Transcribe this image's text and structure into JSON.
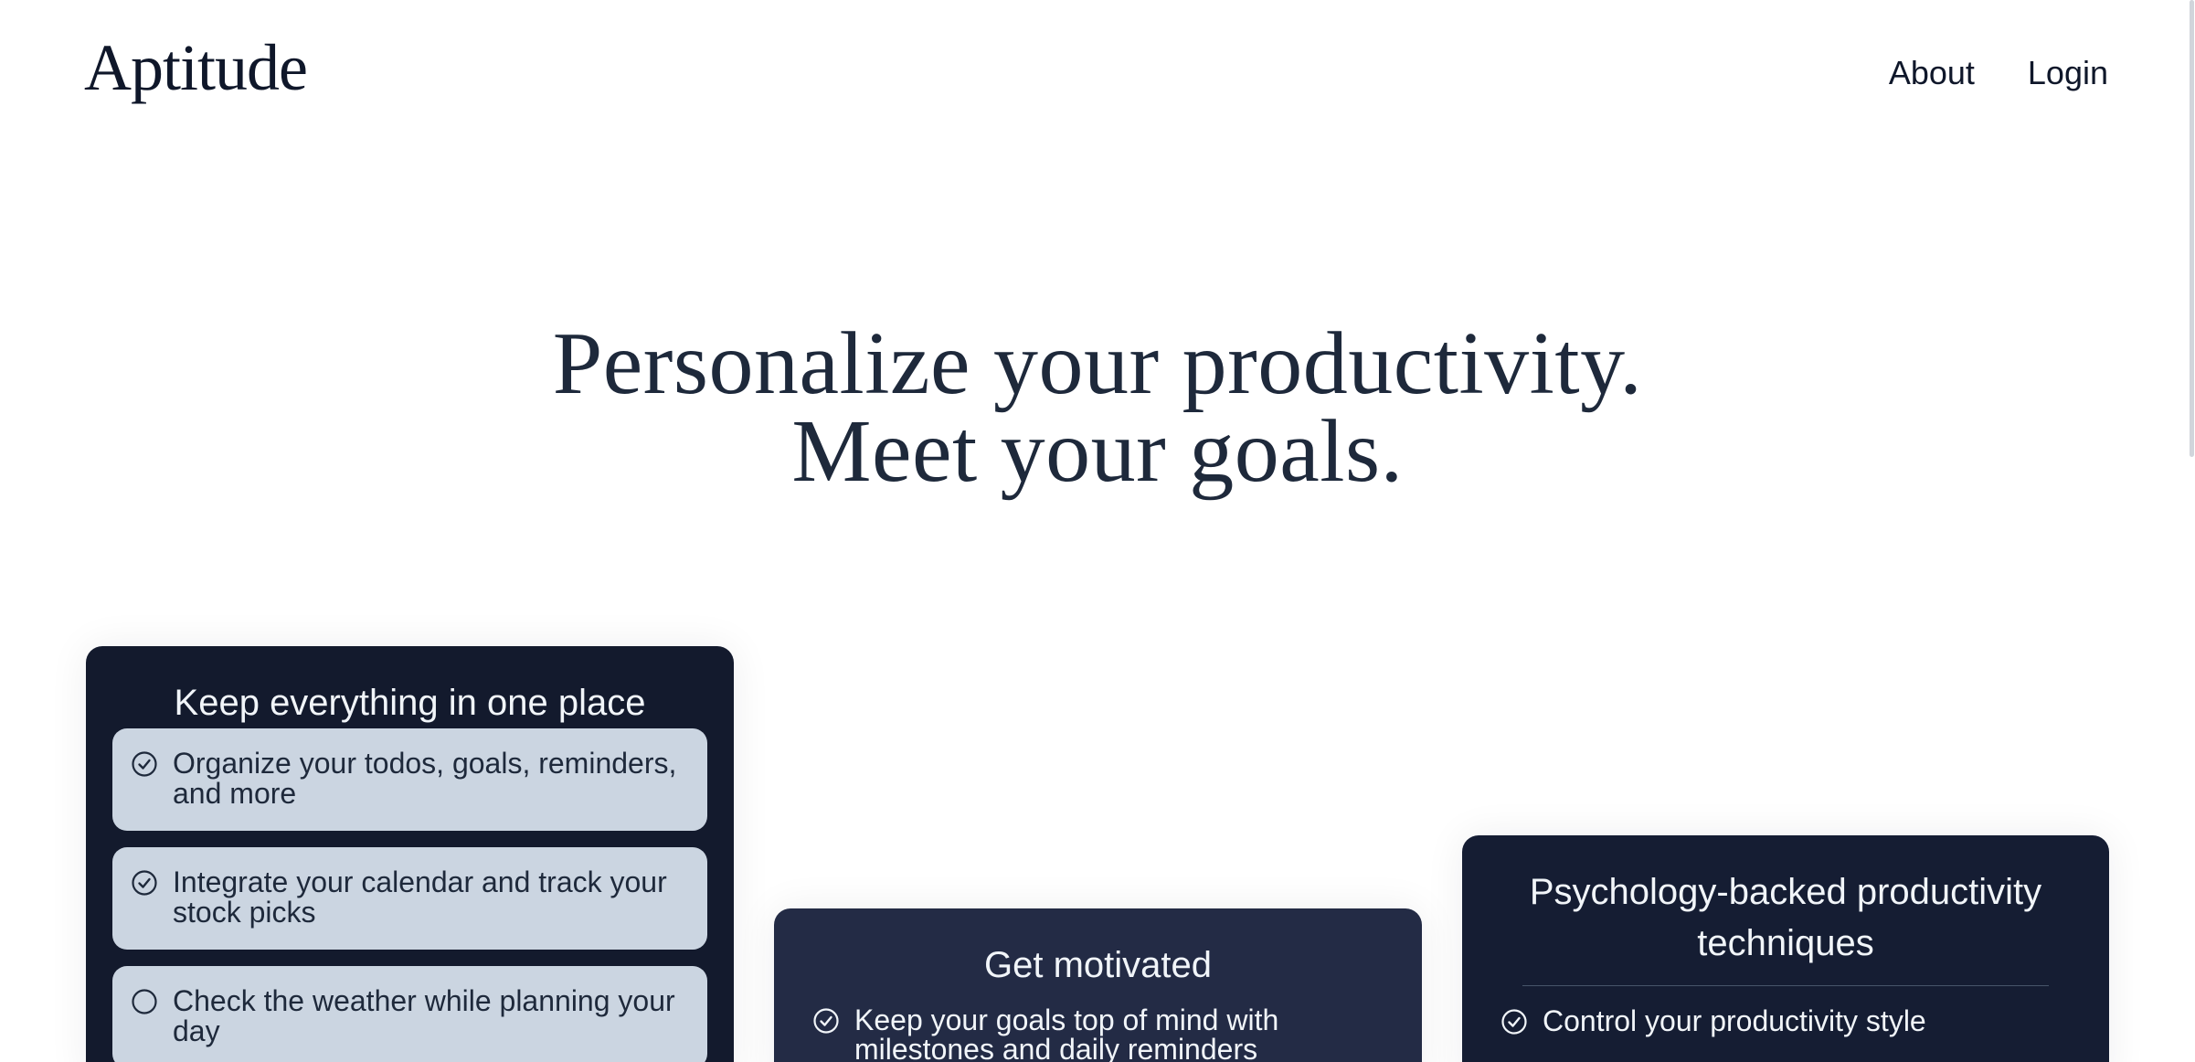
{
  "header": {
    "brand": "Aptitude",
    "nav": [
      {
        "label": "About"
      },
      {
        "label": "Login"
      }
    ]
  },
  "hero": {
    "line1": "Personalize your productivity.",
    "line2": "Meet your goals."
  },
  "cards": [
    {
      "title": "Keep everything in one place",
      "items": [
        {
          "text": "Organize your todos, goals, reminders, and more",
          "icon": "check-circle-icon"
        },
        {
          "text": "Integrate your calendar and track your stock picks",
          "icon": "check-circle-icon"
        },
        {
          "text": "Check the weather while planning your day",
          "icon": "circle-icon"
        }
      ]
    },
    {
      "title": "Get motivated",
      "items": [
        {
          "text": "Keep your goals top of mind with milestones and daily reminders",
          "icon": "check-circle-icon"
        }
      ]
    },
    {
      "title": "Psychology-backed productivity techniques",
      "items": [
        {
          "text": "Control your productivity style",
          "icon": "check-circle-icon"
        }
      ]
    }
  ],
  "colors": {
    "text_dark": "#1e293b",
    "card_dark": "#131a2d",
    "card_mid": "#232b45",
    "pill_bg": "#cbd5e1"
  }
}
